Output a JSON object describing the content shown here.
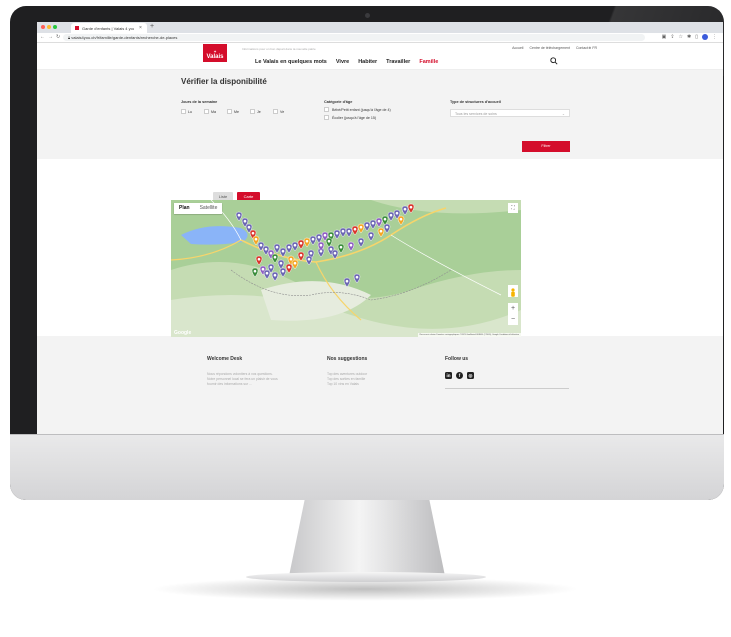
{
  "browser": {
    "tab_title": "Garde d'enfants | Valais 4 you",
    "url": "valais4you.ch/fr/famille/garde-denfants/recherche-de-places"
  },
  "site": {
    "logo_text": "Valais",
    "tagline": "Informations pour un bon départ dans ta nouvelle patrie",
    "top_links": [
      "Accueil",
      "Centre de téléchargement",
      "Contact"
    ],
    "language": "FR",
    "nav": [
      {
        "label": "Le Valais en quelques mots"
      },
      {
        "label": "Vivre"
      },
      {
        "label": "Habiter"
      },
      {
        "label": "Travailler"
      },
      {
        "label": "Famille"
      }
    ]
  },
  "availability": {
    "title": "Vérifier la disponibilité",
    "days_label": "Jours de la semaine",
    "days": [
      "Lu",
      "Ma",
      "Me",
      "Je",
      "Ve"
    ],
    "category_label": "Catégorie d'âge",
    "categories": [
      "Bébé/Petit enfant (jusqu'à l'âge de 4)",
      "Écolier (jusqu'à l'âge de 15)"
    ],
    "structures_label": "Type de structures d'accueil",
    "select_placeholder": "Tous les services de soins",
    "filter_button": "Filtrer"
  },
  "view_buttons": {
    "list": "Liste",
    "map": "Carte"
  },
  "map": {
    "tabs": [
      "Plan",
      "Satellite"
    ],
    "footer": "Raccourcis clavier   Données cartographiques ©2023 GeoBasis-DE/BKG (©2009), Google   Conditions d'utilisation",
    "brand": "Google"
  },
  "footer": {
    "welcome_title": "Welcome Desk",
    "welcome_text": [
      "Nous répondons volontiers à vos questions.",
      "Notre personnel local se fera un plaisir de vous",
      "fournir des informations sur ..."
    ],
    "suggestions_title": "Nos suggestions",
    "suggestions": [
      "Top des aventures outdoor",
      "Top des sorties en famille",
      "Top 10 vins en Valais"
    ],
    "follow_title": "Follow us"
  },
  "colors": {
    "brand_red": "#d40d2b",
    "gray_bg": "#f3f3f3"
  }
}
